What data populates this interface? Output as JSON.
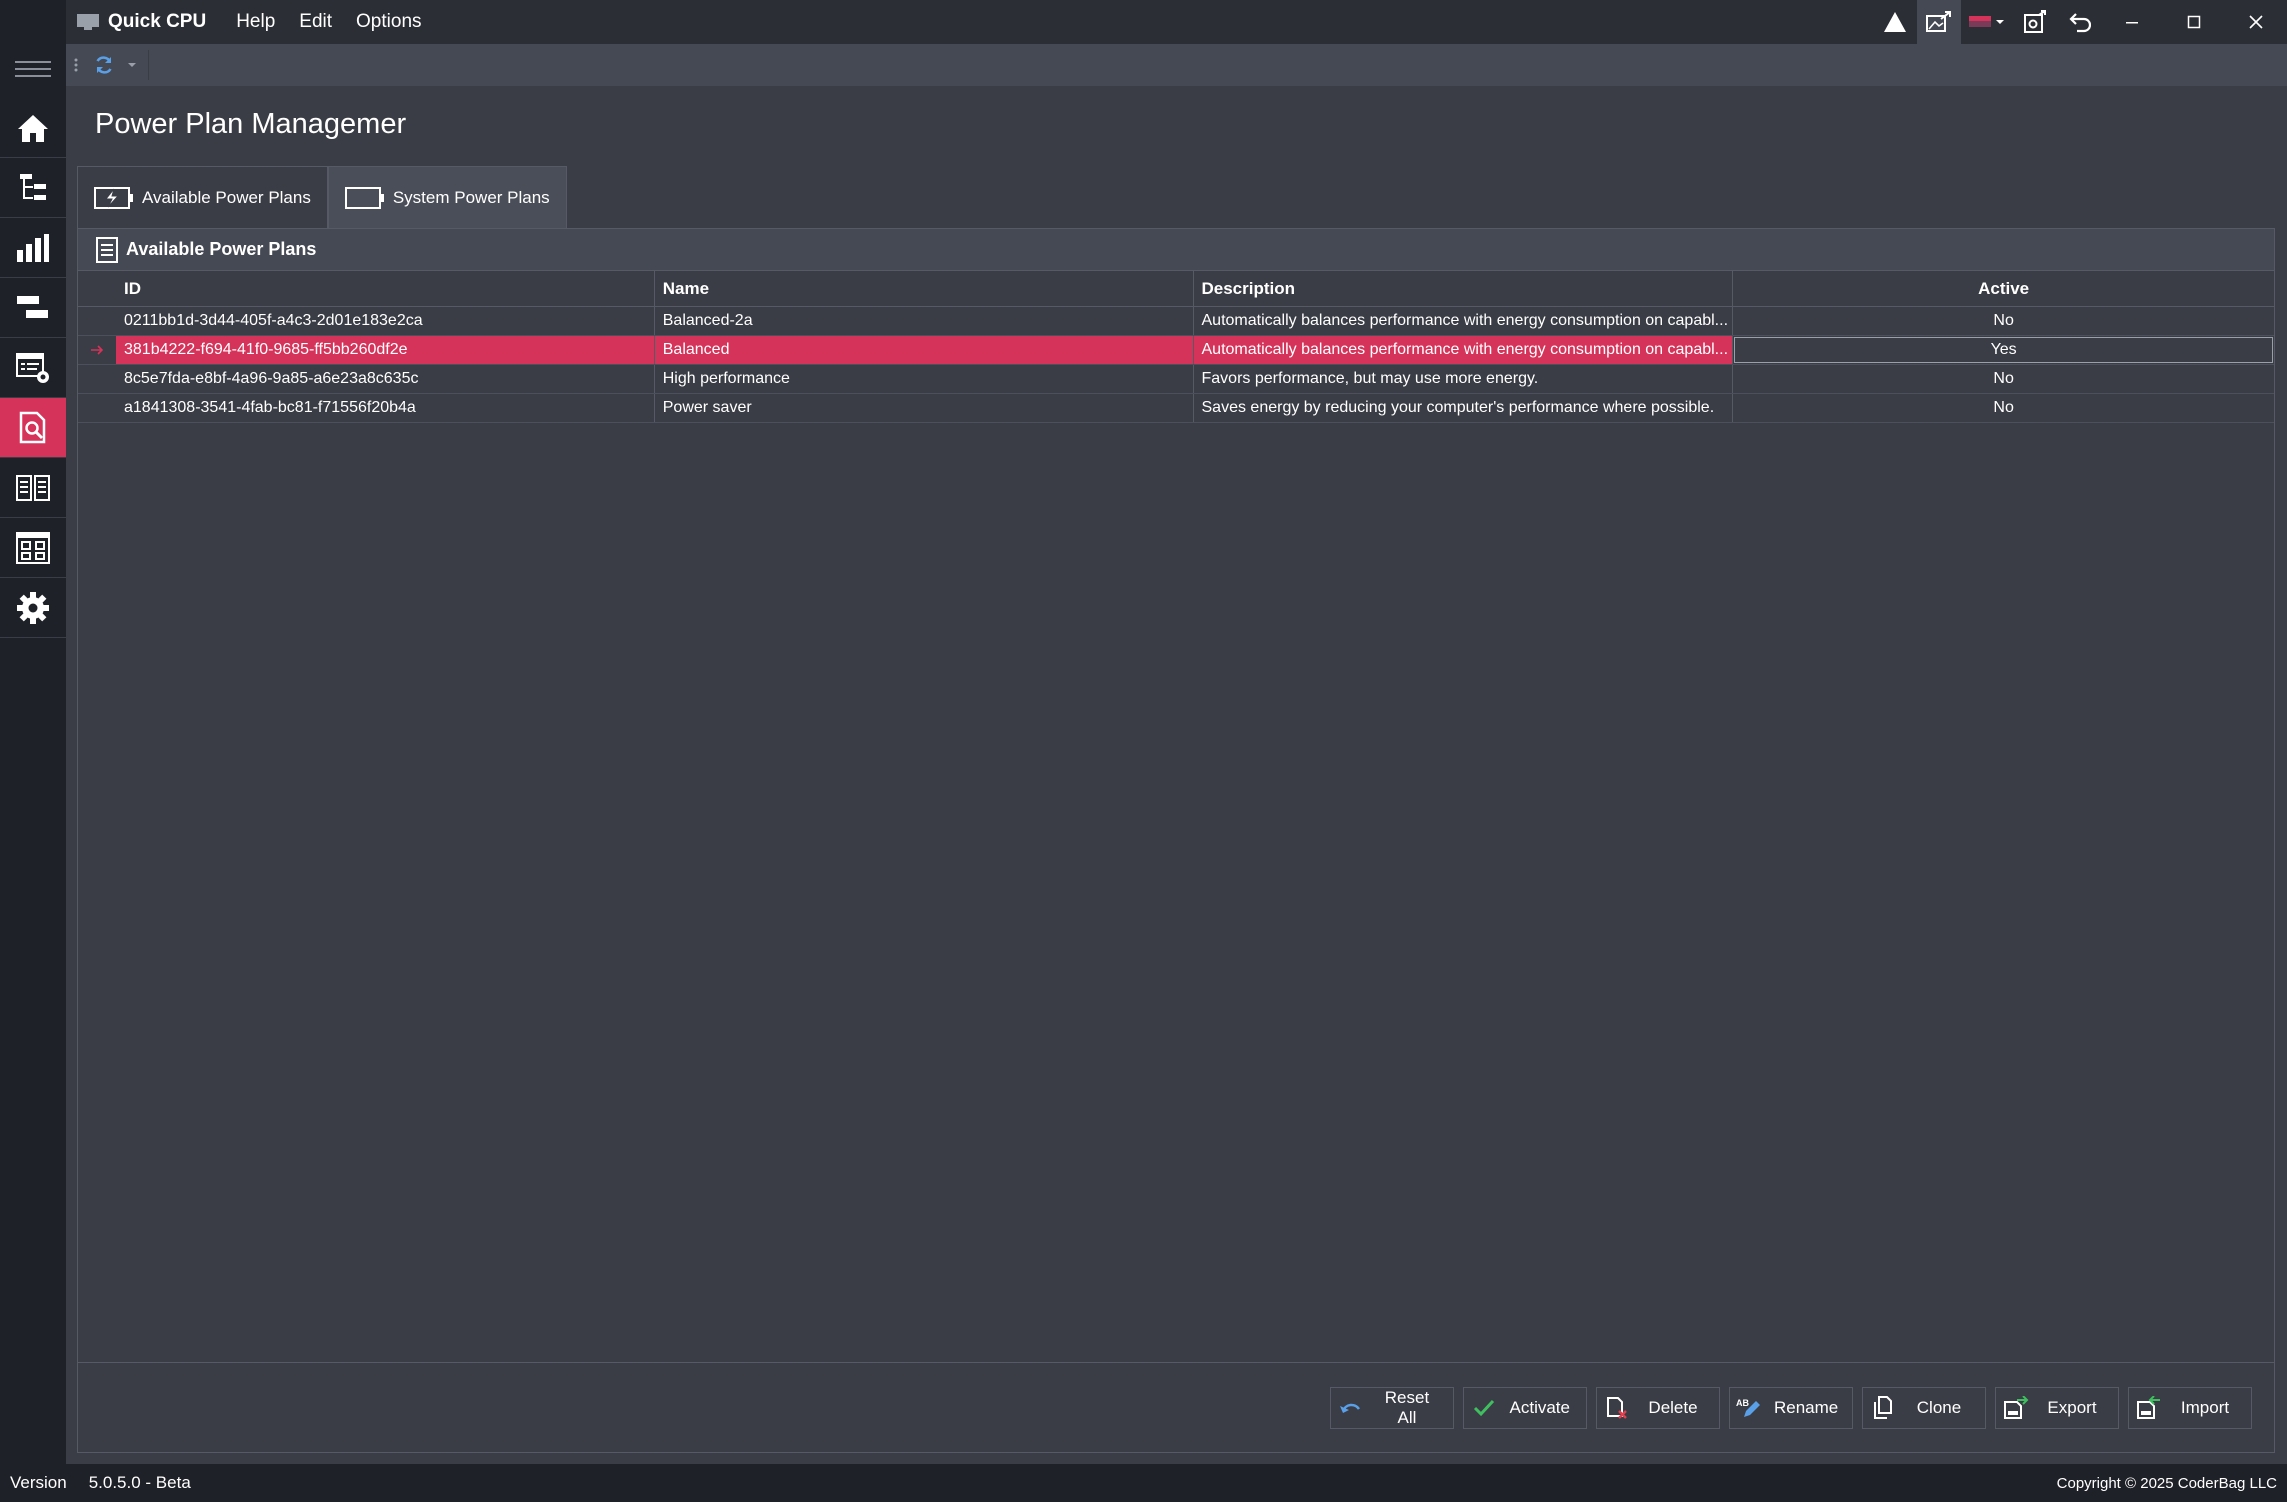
{
  "app": {
    "name": "Quick CPU"
  },
  "menu": [
    "Help",
    "Edit",
    "Options"
  ],
  "page": {
    "title": "Power Plan Managemer"
  },
  "tabs": [
    {
      "label": "Available Power Plans",
      "active": true
    },
    {
      "label": "System Power Plans",
      "active": false
    }
  ],
  "panel": {
    "title": "Available Power Plans"
  },
  "grid": {
    "columns": [
      "ID",
      "Name",
      "Description",
      "Active"
    ],
    "rows": [
      {
        "id": "0211bb1d-3d44-405f-a4c3-2d01e183e2ca",
        "name": "Balanced-2a",
        "description": "Automatically balances performance with energy consumption on capabl...",
        "active": "No"
      },
      {
        "id": "381b4222-f694-41f0-9685-ff5bb260df2e",
        "name": "Balanced",
        "description": "Automatically balances performance with energy consumption on capabl...",
        "active": "Yes"
      },
      {
        "id": "8c5e7fda-e8bf-4a96-9a85-a6e23a8c635c",
        "name": "High performance",
        "description": "Favors performance, but may use more energy.",
        "active": "No"
      },
      {
        "id": "a1841308-3541-4fab-bc81-f71556f20b4a",
        "name": "Power saver",
        "description": "Saves energy by reducing your computer's performance where possible.",
        "active": "No"
      }
    ],
    "selected_row": 1
  },
  "actions": {
    "reset_all": "Reset All",
    "activate": "Activate",
    "delete": "Delete",
    "rename": "Rename",
    "clone": "Clone",
    "export": "Export",
    "import": "Import"
  },
  "status": {
    "version_label": "Version",
    "version": "5.0.5.0 - Beta",
    "copyright": "Copyright © 2025 CoderBag LLC"
  },
  "colors": {
    "accent": "#d6335a",
    "background": "#3a3d45",
    "sidebar": "#1f2128",
    "titlebar": "#2b2e35",
    "activate_check": "#3fbf5f",
    "delete_x": "#e04050",
    "refresh": "#5aa0e8"
  }
}
